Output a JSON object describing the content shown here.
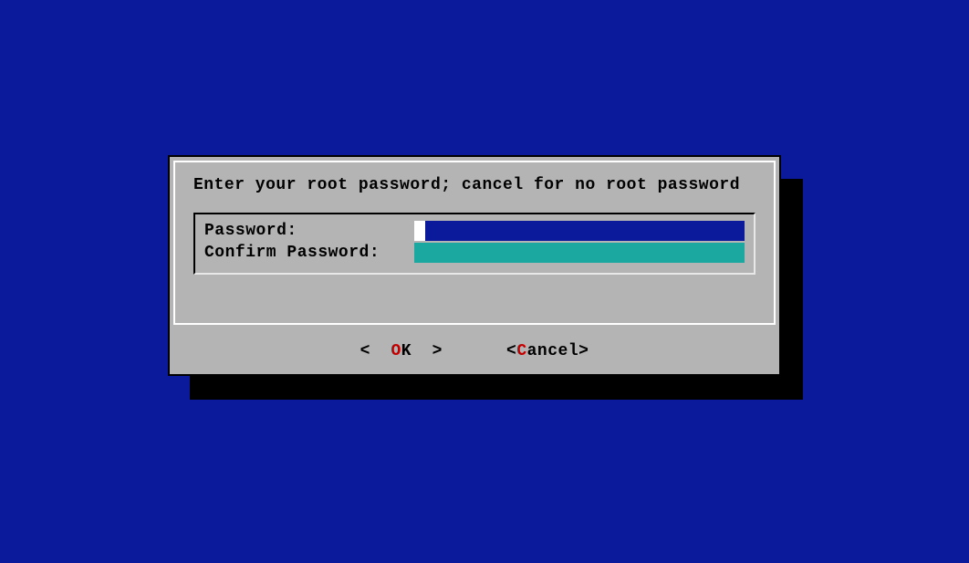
{
  "dialog": {
    "prompt": "Enter your root password; cancel for no root password",
    "fields": {
      "password": {
        "label": "Password:",
        "value": ""
      },
      "confirm": {
        "label": "Confirm Password:",
        "value": ""
      }
    },
    "buttons": {
      "ok": {
        "open": "<  ",
        "hotkey": "O",
        "rest": "K  >"
      },
      "cancel": {
        "open": "<",
        "hotkey": "C",
        "rest": "ancel>"
      }
    }
  },
  "colors": {
    "background": "#0a1a9a",
    "panel": "#b4b4b4",
    "confirm_field": "#1aa8a0",
    "hotkey": "#c00000"
  }
}
